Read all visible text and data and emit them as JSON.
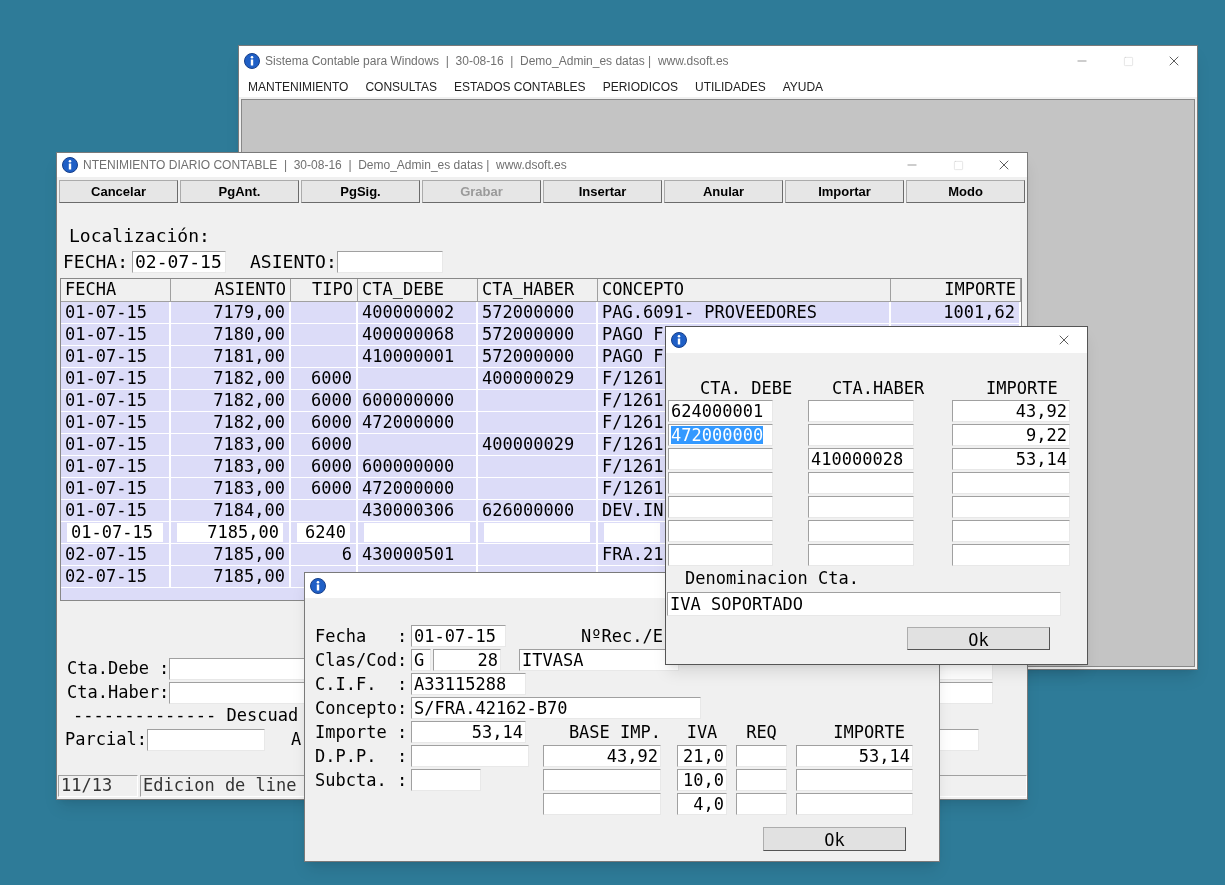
{
  "main_window": {
    "title": "Sistema Contable para Windows  |  30-08-16  |  Demo_Admin_es datas |  www.dsoft.es",
    "menu": [
      "MANTENIMIENTO",
      "CONSULTAS",
      "ESTADOS CONTABLES",
      "PERIODICOS",
      "UTILIDADES",
      "AYUDA"
    ]
  },
  "diario_window": {
    "title": "NTENIMIENTO DIARIO CONTABLE  |  30-08-16  |  Demo_Admin_es datas |  www.dsoft.es",
    "buttons": [
      {
        "label": "Cancelar",
        "disabled": false
      },
      {
        "label": "PgAnt.",
        "disabled": false
      },
      {
        "label": "PgSig.",
        "disabled": false
      },
      {
        "label": "Grabar",
        "disabled": true
      },
      {
        "label": "Insertar",
        "disabled": false
      },
      {
        "label": "Anular",
        "disabled": false
      },
      {
        "label": "Importar",
        "disabled": false
      },
      {
        "label": "Modo",
        "disabled": false
      }
    ],
    "locate_label": "Localización:",
    "fecha_label": "FECHA:",
    "fecha_value": "02-07-15",
    "asiento_label": "ASIENTO:",
    "table": {
      "columns": [
        "FECHA",
        "ASIENTO",
        "TIPO",
        "CTA_DEBE",
        "CTA_HABER",
        "CONCEPTO",
        "IMPORTE"
      ],
      "rows": [
        {
          "cells": [
            "01-07-15",
            "7179,00",
            "",
            "400000002",
            "572000000",
            "PAG.6091- PROVEEDORES",
            "1001,62"
          ],
          "editing": false
        },
        {
          "cells": [
            "01-07-15",
            "7180,00",
            "",
            "400000068",
            "572000000",
            "PAGO F",
            ""
          ],
          "editing": false
        },
        {
          "cells": [
            "01-07-15",
            "7181,00",
            "",
            "410000001",
            "572000000",
            "PAGO F",
            ""
          ],
          "editing": false
        },
        {
          "cells": [
            "01-07-15",
            "7182,00",
            "6000",
            "",
            "400000029",
            "F/1261",
            ""
          ],
          "editing": false
        },
        {
          "cells": [
            "01-07-15",
            "7182,00",
            "6000",
            "600000000",
            "",
            "F/1261",
            ""
          ],
          "editing": false
        },
        {
          "cells": [
            "01-07-15",
            "7182,00",
            "6000",
            "472000000",
            "",
            "F/1261",
            ""
          ],
          "editing": false
        },
        {
          "cells": [
            "01-07-15",
            "7183,00",
            "6000",
            "",
            "400000029",
            "F/1261",
            ""
          ],
          "editing": false
        },
        {
          "cells": [
            "01-07-15",
            "7183,00",
            "6000",
            "600000000",
            "",
            "F/1261",
            ""
          ],
          "editing": false
        },
        {
          "cells": [
            "01-07-15",
            "7183,00",
            "6000",
            "472000000",
            "",
            "F/1261",
            ""
          ],
          "editing": false
        },
        {
          "cells": [
            "01-07-15",
            "7184,00",
            "",
            "430000306",
            "626000000",
            "DEV.IN",
            ""
          ],
          "editing": false
        },
        {
          "cells": [
            "01-07-15",
            "7185,00",
            "6240",
            "",
            "",
            "",
            ""
          ],
          "editing": true
        },
        {
          "cells": [
            "02-07-15",
            "7185,00",
            "6",
            "430000501",
            "",
            "FRA.21",
            ""
          ],
          "editing": false
        },
        {
          "cells": [
            "02-07-15",
            "7185,00",
            "",
            "",
            "",
            "",
            ""
          ],
          "editing": false
        }
      ]
    },
    "cta_debe_label": "Cta.Debe :",
    "cta_haber_label": "Cta.Haber:",
    "descuadre_label": "-------------- Descuad",
    "parcial_label": "Parcial:",
    "parcial_next_label": "A",
    "status": [
      "11/13",
      "Edicion de line"
    ]
  },
  "invoice_dialog": {
    "fecha_label": "Fecha   :",
    "fecha": "01-07-15",
    "rec_label": "NºRec./E",
    "clascod_label": "Clas/Cod:",
    "clas": "G",
    "cod": "28",
    "name": "ITVASA",
    "cif_label": "C.I.F.  :",
    "cif": "A33115288",
    "concepto_label": "Concepto:",
    "concepto": "S/FRA.42162-B70",
    "importe_label": "Importe :",
    "importe": "53,14",
    "dpp_label": "D.P.P.  :",
    "subcta_label": "Subcta. :",
    "columns": [
      "BASE IMP.",
      "IVA",
      "REQ",
      "IMPORTE"
    ],
    "rows": [
      [
        "43,92",
        "21,0",
        "",
        "53,14"
      ],
      [
        "",
        "10,0",
        "",
        ""
      ],
      [
        "",
        "4,0",
        "",
        ""
      ]
    ],
    "ok": "Ok"
  },
  "accounts_dialog": {
    "columns": [
      "CTA. DEBE",
      "CTA.HABER",
      "IMPORTE"
    ],
    "rows": [
      {
        "cta_debe": "624000001",
        "cta_haber": "",
        "importe": "43,92",
        "debe_highlighted": false
      },
      {
        "cta_debe": "472000000",
        "cta_haber": "",
        "importe": "9,22",
        "debe_highlighted": true
      },
      {
        "cta_debe": "",
        "cta_haber": "410000028",
        "importe": "53,14",
        "debe_highlighted": false
      },
      {
        "cta_debe": "",
        "cta_haber": "",
        "importe": "",
        "debe_highlighted": false
      },
      {
        "cta_debe": "",
        "cta_haber": "",
        "importe": "",
        "debe_highlighted": false
      },
      {
        "cta_debe": "",
        "cta_haber": "",
        "importe": "",
        "debe_highlighted": false
      },
      {
        "cta_debe": "",
        "cta_haber": "",
        "importe": "",
        "debe_highlighted": false
      }
    ],
    "denominacion_label": "Denominacion Cta.",
    "denominacion": "IVA SOPORTADO",
    "ok": "Ok"
  }
}
